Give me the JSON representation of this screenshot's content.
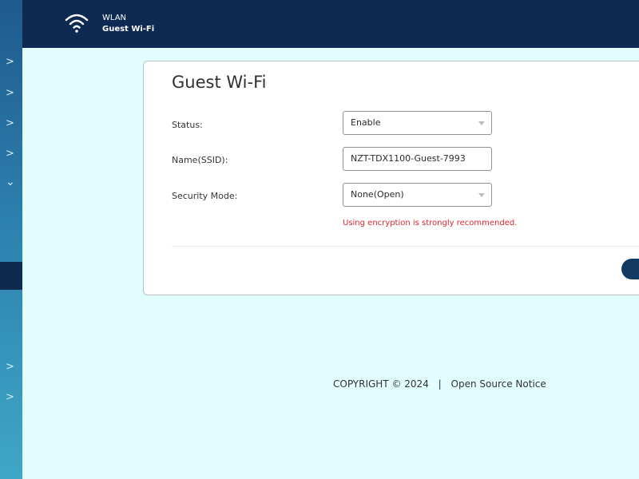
{
  "sidebar": {
    "arrows": [
      ">",
      ">",
      ">",
      ">",
      "⌄",
      ">",
      ">"
    ]
  },
  "header": {
    "section": "WLAN",
    "page": "Guest Wi-Fi",
    "icon": "wifi-icon"
  },
  "card": {
    "title": "Guest Wi-Fi",
    "status": {
      "label": "Status:",
      "value": "Enable"
    },
    "ssid": {
      "label": "Name(SSID):",
      "value": "NZT-TDX1100-Guest-7993"
    },
    "security": {
      "label": "Security Mode:",
      "value": "None(Open)"
    },
    "warning": "Using encryption is strongly recommended."
  },
  "footer": {
    "copyright": "COPYRIGHT © 2024",
    "separator": "|",
    "open_source": "Open Source Notice"
  },
  "colors": {
    "header_bg": "#0f2a52",
    "page_bg": "#e1fdfd",
    "warning": "#e0262e",
    "button": "#133a63"
  }
}
